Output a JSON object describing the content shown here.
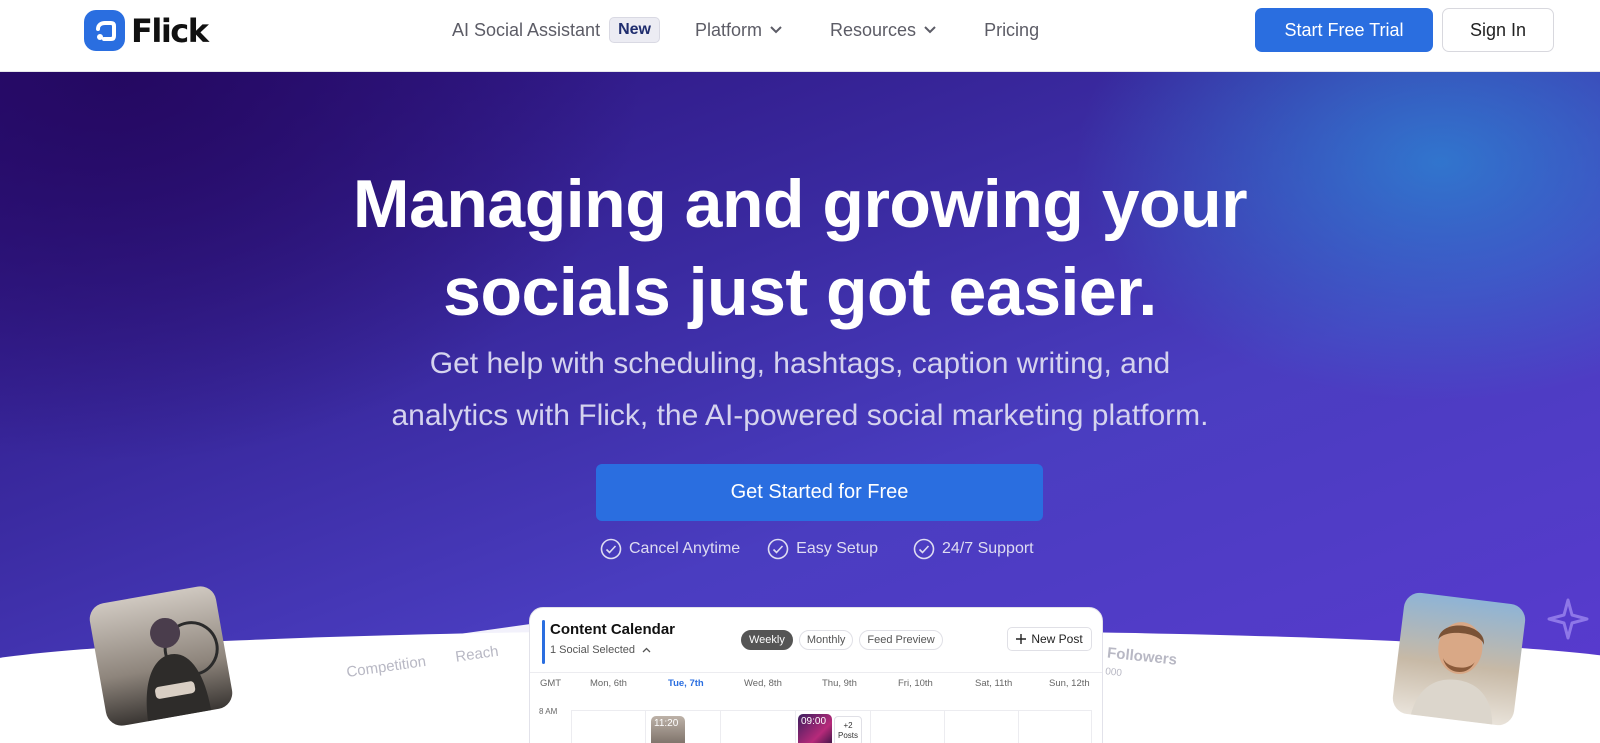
{
  "brand": {
    "name": "Flick",
    "color": "#2a6ee0"
  },
  "nav": {
    "items": [
      {
        "label": "AI Social Assistant",
        "badge": "New"
      },
      {
        "label": "Platform",
        "dropdown": true
      },
      {
        "label": "Resources",
        "dropdown": true
      },
      {
        "label": "Pricing"
      }
    ],
    "trial_label": "Start Free Trial",
    "signin_label": "Sign In"
  },
  "hero": {
    "title_line1": "Managing and growing your",
    "title_line2": "socials just got easier.",
    "subtitle_line1": "Get help with scheduling, hashtags, caption writing, and",
    "subtitle_line2": "analytics with Flick, the AI-powered social marketing platform.",
    "cta_label": "Get Started for Free",
    "perks": [
      "Cancel Anytime",
      "Easy Setup",
      "24/7 Support"
    ]
  },
  "side_panels": {
    "left_tabs": [
      "Competition",
      "Reach"
    ],
    "right_label": "Followers",
    "right_value": "000"
  },
  "calendar": {
    "title": "Content Calendar",
    "selected": "1 Social Selected",
    "views": [
      "Weekly",
      "Monthly",
      "Feed Preview"
    ],
    "active_view": "Weekly",
    "new_post_label": "New Post",
    "timezone": "GMT",
    "days": [
      "Mon, 6th",
      "Tue, 7th",
      "Wed, 8th",
      "Thu, 9th",
      "Fri, 10th",
      "Sat, 11th",
      "Sun, 12th"
    ],
    "today": "Tue, 7th",
    "time_label": "8 AM",
    "posts": [
      {
        "time": "11:20"
      },
      {
        "time": "09:00"
      }
    ],
    "more_posts": "+2 Posts"
  }
}
